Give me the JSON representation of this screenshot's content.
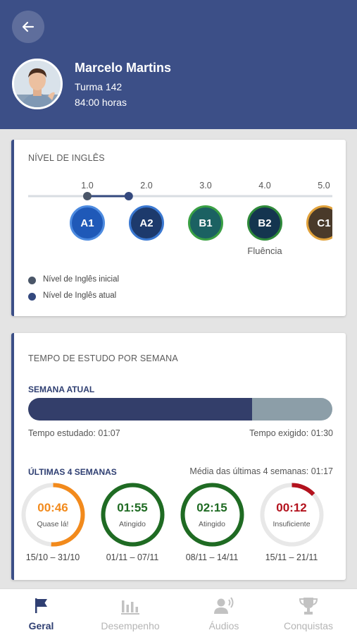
{
  "profile": {
    "name": "Marcelo Martins",
    "turma": "Turma 142",
    "horas": "84:00 horas"
  },
  "level_card": {
    "title": "NÍVEL DE INGLÊS",
    "scale": [
      "1.0",
      "2.0",
      "3.0",
      "4.0",
      "5.0"
    ],
    "levels": [
      {
        "code": "A1",
        "color": "#1f59b8",
        "border": "#4d8be0"
      },
      {
        "code": "A2",
        "color": "#1d3a6c",
        "border": "#3a78d1"
      },
      {
        "code": "B1",
        "color": "#1b6162",
        "border": "#3aa044"
      },
      {
        "code": "B2",
        "color": "#14354f",
        "border": "#2f8a3a"
      },
      {
        "code": "C1",
        "color": "#4a3a2a",
        "border": "#e0a13a"
      }
    ],
    "fluency_label": "Fluência",
    "initial_level": 1.0,
    "current_level": 1.7,
    "legend_initial": "Nível de Inglês inicial",
    "legend_current": "Nível de Inglês atual",
    "initial_color": "#4a5668",
    "current_color": "#34497e"
  },
  "study_card": {
    "title": "TEMPO DE ESTUDO POR SEMANA",
    "current_week_label": "SEMANA ATUAL",
    "progress_fraction": 0.737,
    "studied_label": "Tempo estudado: 01:07",
    "required_label": "Tempo exigido: 01:30",
    "last_weeks_label": "ÚLTIMAS 4 SEMANAS",
    "average_label": "Média das últimas 4 semanas: 01:17",
    "weeks": [
      {
        "time": "00:46",
        "status": "Quase lá!",
        "dates": "15/10 – 31/10",
        "fraction": 0.51,
        "color": "#f28a1c"
      },
      {
        "time": "01:55",
        "status": "Atingido",
        "dates": "01/11 – 07/11",
        "fraction": 1.0,
        "color": "#1f6b23"
      },
      {
        "time": "02:15",
        "status": "Atingido",
        "dates": "08/11 – 14/11",
        "fraction": 1.0,
        "color": "#1f6b23"
      },
      {
        "time": "00:12",
        "status": "Insuficiente",
        "dates": "15/11 – 21/11",
        "fraction": 0.13,
        "color": "#b3121d"
      }
    ]
  },
  "nav": [
    {
      "label": "Geral",
      "icon": "flag-icon",
      "active": true
    },
    {
      "label": "Desempenho",
      "icon": "bar-chart-icon",
      "active": false
    },
    {
      "label": "Áudios",
      "icon": "speaker-icon",
      "active": false
    },
    {
      "label": "Conquistas",
      "icon": "trophy-icon",
      "active": false
    }
  ]
}
